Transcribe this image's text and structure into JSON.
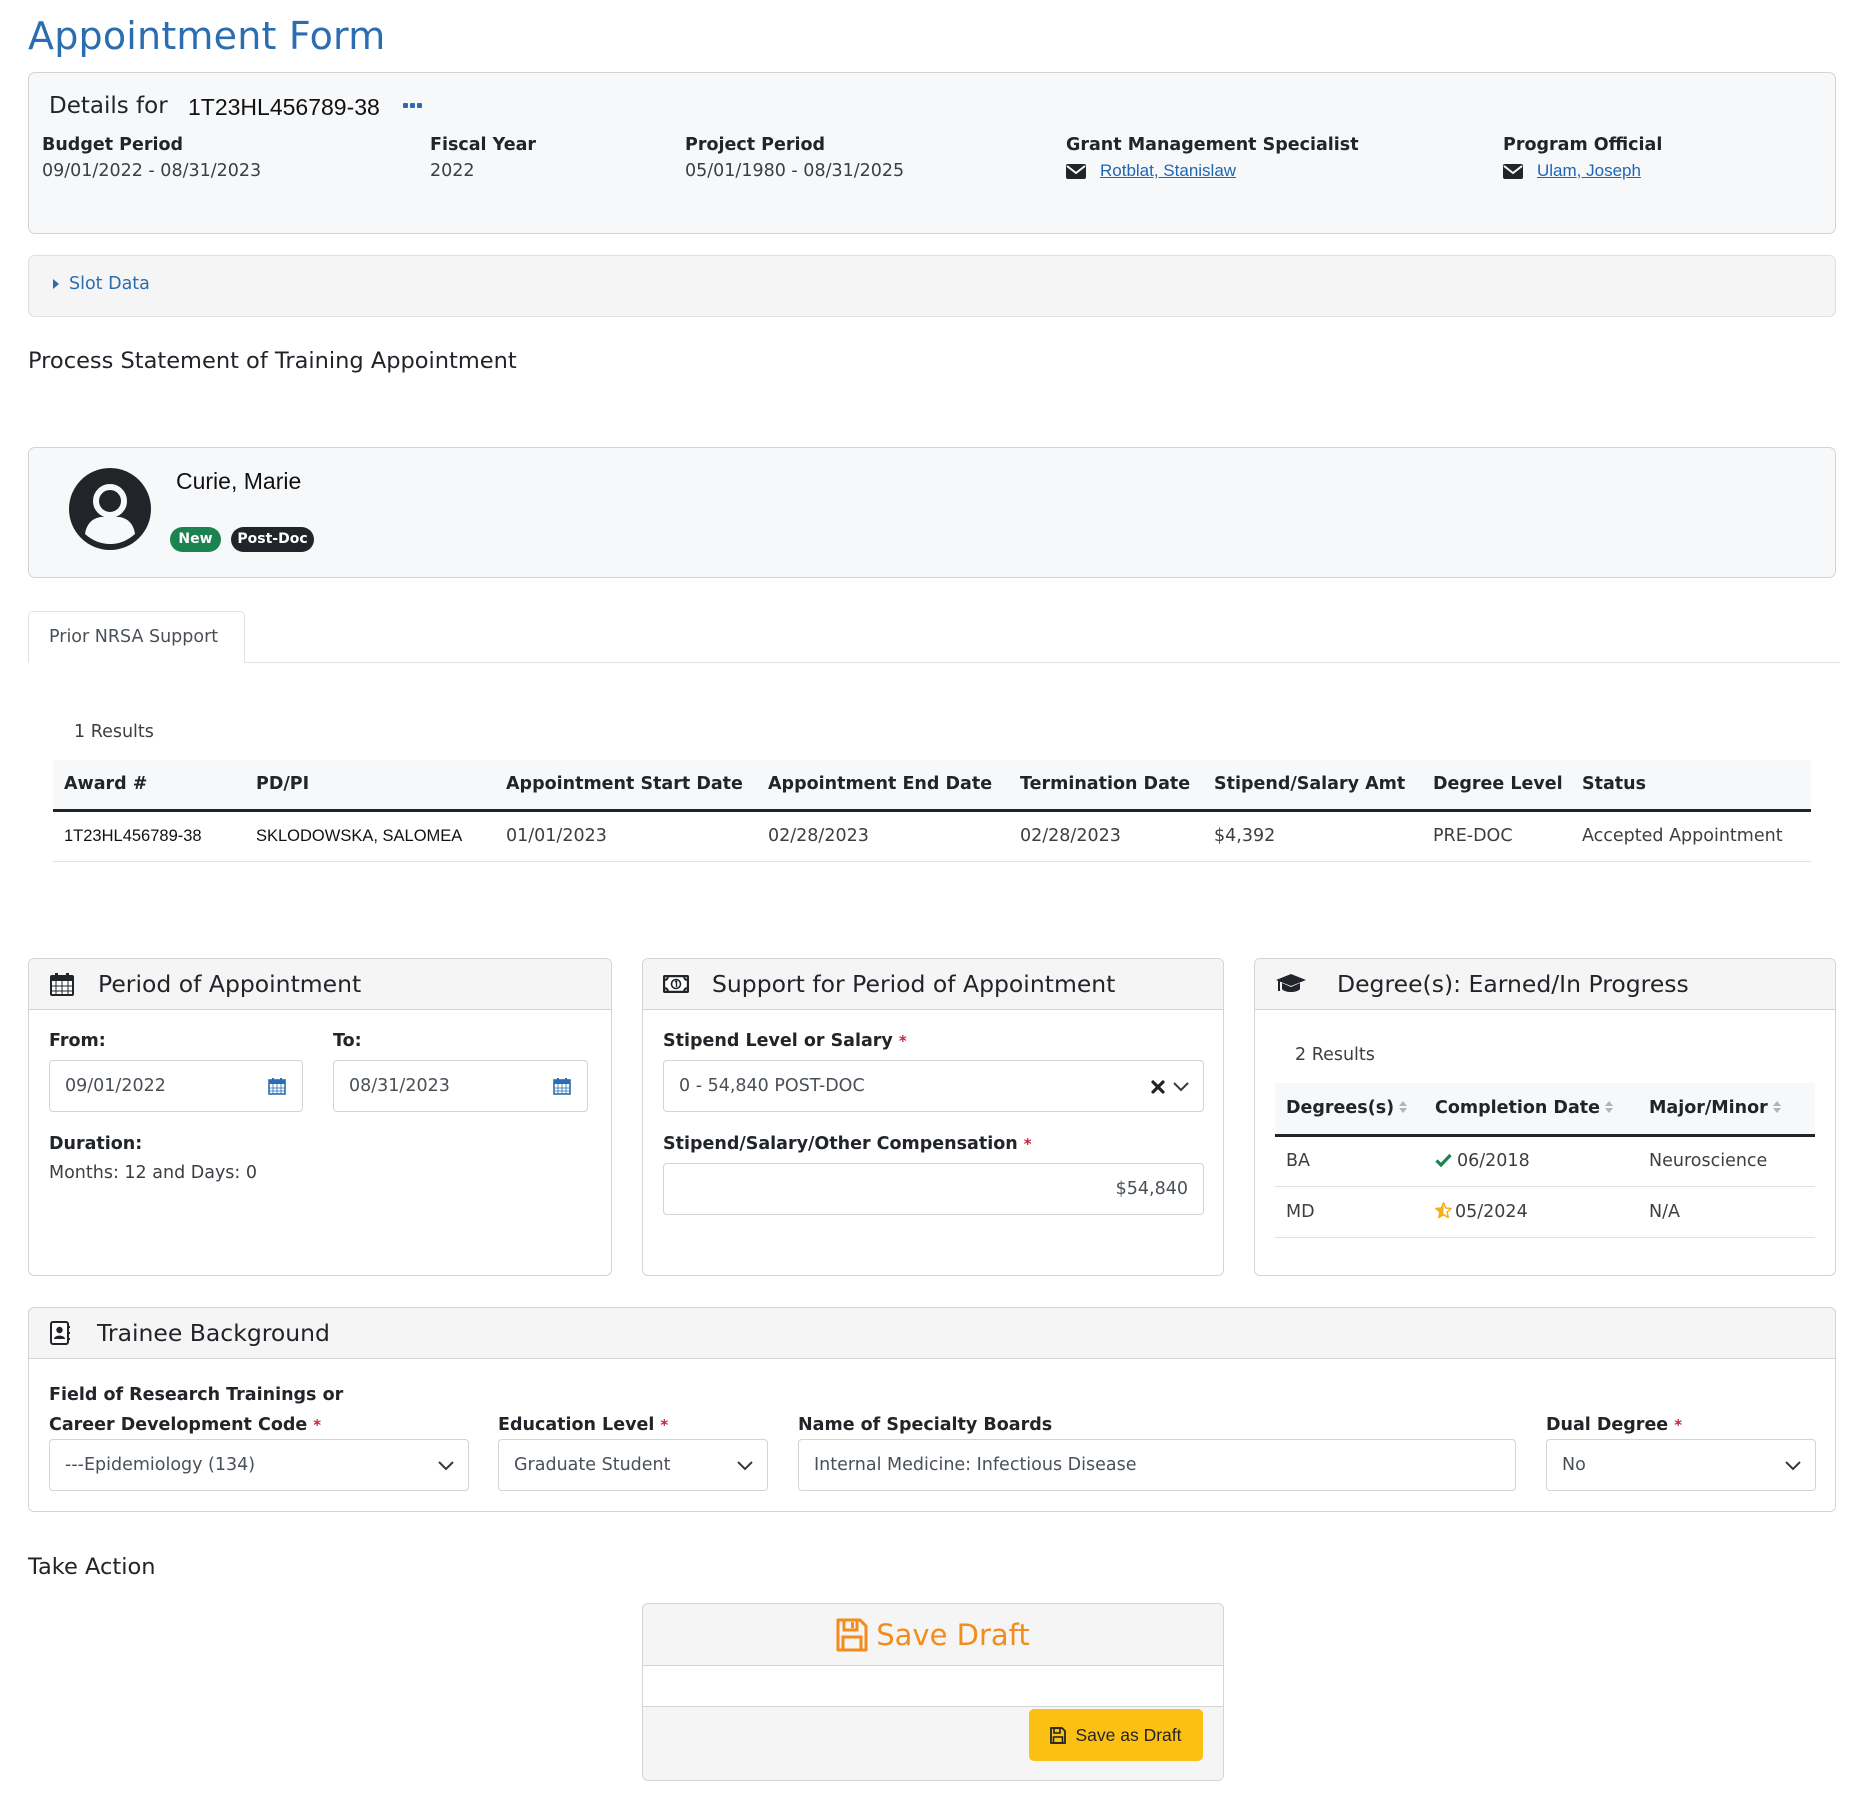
{
  "page": {
    "title": "Appointment Form"
  },
  "details": {
    "prefix": "Details for",
    "award_number": "1T23HL456789-38",
    "more_icon": "ellipsis-icon",
    "fields": [
      {
        "label": "Budget Period",
        "value": "09/01/2022 - 08/31/2023"
      },
      {
        "label": "Fiscal Year",
        "value": "2022"
      },
      {
        "label": "Project Period",
        "value": "05/01/1980 - 08/31/2025"
      },
      {
        "label": "Grant Management Specialist",
        "value": "Rotblat, Stanislaw",
        "icon": "envelope-icon"
      },
      {
        "label": "Program Official",
        "value": "Ulam, Joseph",
        "icon": "envelope-icon"
      }
    ]
  },
  "slot_data": {
    "label": "Slot Data",
    "expanded": false
  },
  "section_heading": "Process Statement of Training Appointment",
  "trainee": {
    "name": "Curie, Marie",
    "badges": [
      {
        "label": "New",
        "color": "#1c8350"
      },
      {
        "label": "Post-Doc",
        "color": "#212529"
      }
    ]
  },
  "tabs": [
    {
      "label": "Prior NRSA Support",
      "active": true
    }
  ],
  "nrsa": {
    "results": "1 Results",
    "columns": [
      "Award #",
      "PD/PI",
      "Appointment Start Date",
      "Appointment End Date",
      "Termination Date",
      "Stipend/Salary Amt",
      "Degree Level",
      "Status"
    ],
    "rows": [
      [
        "1T23HL456789-38",
        "SKLODOWSKA, SALOMEA",
        "01/01/2023",
        "02/28/2023",
        "02/28/2023",
        "$4,392",
        "PRE-DOC",
        "Accepted Appointment"
      ]
    ]
  },
  "period": {
    "title": "Period of Appointment",
    "from_label": "From:",
    "from_value": "09/01/2022",
    "to_label": "To:",
    "to_value": "08/31/2023",
    "duration_label": "Duration:",
    "duration_value": "Months: 12 and Days: 0"
  },
  "support": {
    "title": "Support for Period of Appointment",
    "stipend_level_label": "Stipend Level or Salary",
    "stipend_level_value": "0 - 54,840 POST-DOC",
    "compensation_label": "Stipend/Salary/Other Compensation",
    "compensation_value": "$54,840",
    "required_mark": "*"
  },
  "degrees": {
    "title": "Degree(s): Earned/In Progress",
    "results": "2 Results",
    "columns": [
      "Degrees(s)",
      "Completion Date",
      "Major/Minor"
    ],
    "rows": [
      {
        "degree": "BA",
        "status_icon": "check-icon",
        "date": "06/2018",
        "major": "Neuroscience"
      },
      {
        "degree": "MD",
        "status_icon": "half-star-icon",
        "date": "05/2024",
        "major": "N/A"
      }
    ]
  },
  "background": {
    "title": "Trainee Background",
    "field_label_line1": "Field of Research Trainings or",
    "field_label_line2": "Career Development Code",
    "field_value": "---Epidemiology (134)",
    "education_label": "Education Level",
    "education_value": "Graduate Student",
    "boards_label": "Name of Specialty Boards",
    "boards_value": "Internal Medicine: Infectious Disease",
    "dual_label": "Dual Degree",
    "dual_value": "No",
    "required_mark": "*"
  },
  "take_action": {
    "heading": "Take Action",
    "card_title": "Save Draft",
    "button_label": "Save as Draft",
    "accent": "#f28c1c",
    "button_color": "#fcc012"
  }
}
